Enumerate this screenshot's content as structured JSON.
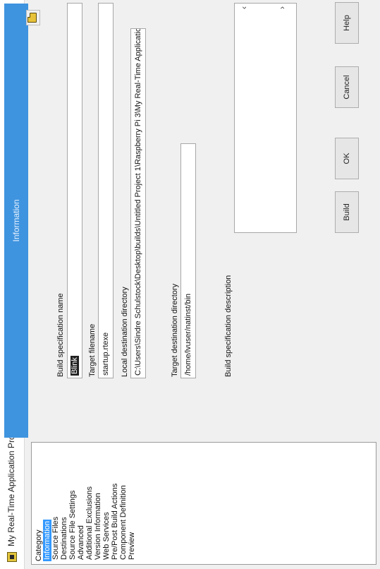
{
  "window": {
    "title": "My Real-Time Application Properties",
    "close_glyph": "×"
  },
  "category": {
    "header": "Category",
    "items": [
      "Information",
      "Source Files",
      "Destinations",
      "Source File Settings",
      "Advanced",
      "Additional Exclusions",
      "Version Information",
      "Web Services",
      "Pre/Post Build Actions",
      "Component Definition",
      "Preview"
    ],
    "selected": "Information"
  },
  "page": {
    "header": "Information",
    "build_spec_name_label": "Build specification name",
    "build_spec_name_value": "Blink",
    "target_filename_label": "Target filename",
    "target_filename_value": "startup.rtexe",
    "local_dest_label": "Local destination directory",
    "local_dest_value": "C:\\Users\\Sindre Schulstock\\Desktop\\builds\\Untitled Project 1\\Raspberry Pi 3\\My Real-Time Application",
    "target_dest_label": "Target destination directory",
    "target_dest_value": "/home/lvuser/natinst/bin",
    "description_label": "Build specification description",
    "description_value": "",
    "scroll_left": "‹",
    "scroll_right": "›"
  },
  "buttons": {
    "build": "Build",
    "ok": "OK",
    "cancel": "Cancel",
    "help": "Help"
  },
  "colors": {
    "header_blue": "#3f94df",
    "selection_blue": "#3399ff"
  }
}
